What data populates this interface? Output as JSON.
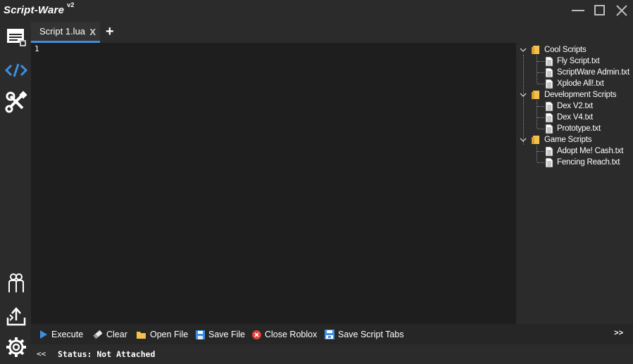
{
  "app": {
    "name": "Script-Ware",
    "version": "v2"
  },
  "tabs": [
    {
      "label": "Script 1.lua",
      "close": "X"
    }
  ],
  "tab_add_label": "+",
  "editor": {
    "line_numbers": [
      "1"
    ],
    "content": ""
  },
  "explorer": {
    "folders": [
      {
        "name": "Cool Scripts",
        "files": [
          "Fly Script.txt",
          "ScriptWare Admin.txt",
          "Xplode All!.txt"
        ]
      },
      {
        "name": "Development Scripts",
        "files": [
          "Dex V2.txt",
          "Dex V4.txt",
          "Prototype.txt"
        ]
      },
      {
        "name": "Game Scripts",
        "files": [
          "Adopt Me! Cash.txt",
          "Fencing Reach.txt"
        ]
      }
    ]
  },
  "toolbar": {
    "execute": "Execute",
    "clear": "Clear",
    "open_file": "Open File",
    "save_file": "Save File",
    "close_roblox": "Close Roblox",
    "save_tabs": "Save Script Tabs",
    "more": ">>"
  },
  "status": {
    "collapse": "<<",
    "text": "Status: Not Attached"
  },
  "colors": {
    "accent": "#3d8fe0",
    "editor_bg": "#1e1e1e",
    "chrome_bg": "#2b2b2b",
    "folder": "#f5c04a",
    "close_roblox": "#e0433a"
  },
  "icons": {
    "sidebar": [
      "editor-window-icon",
      "code-icon",
      "tools-icon",
      "users-icon",
      "share-icon",
      "settings-gear-icon"
    ],
    "window": [
      "minimize-icon",
      "maximize-icon",
      "close-icon"
    ]
  }
}
